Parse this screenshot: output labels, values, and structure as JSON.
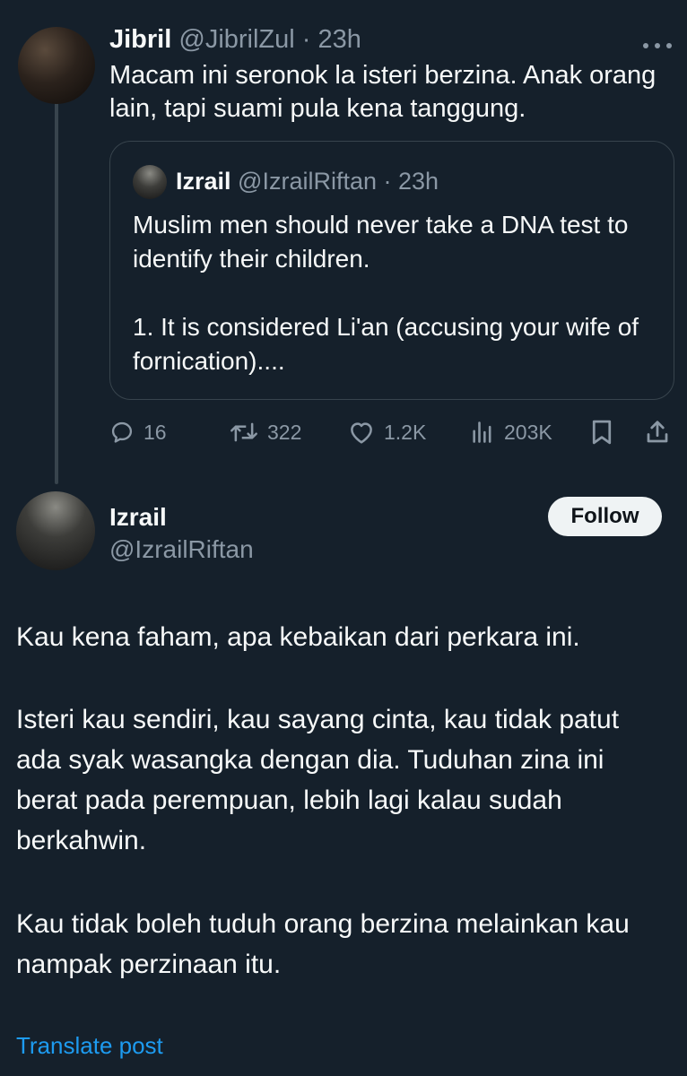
{
  "parent_tweet": {
    "author_name": "Jibril",
    "author_handle": "@JibrilZul",
    "time": "23h",
    "text": "Macam ini seronok la isteri berzina. Anak orang lain, tapi suami pula kena tanggung.",
    "quoted": {
      "author_name": "Izrail",
      "author_handle": "@IzrailRiftan",
      "time": "23h",
      "paragraphs": [
        "Muslim men should never take a DNA test to identify their children.",
        "1. It is considered Li'an (accusing your wife of fornication)...."
      ]
    },
    "metrics": {
      "replies": "16",
      "reposts": "322",
      "likes": "1.2K",
      "views": "203K"
    }
  },
  "reply_tweet": {
    "author_name": "Izrail",
    "author_handle": "@IzrailRiftan",
    "follow_label": "Follow",
    "paragraphs": [
      "Kau kena faham, apa kebaikan dari perkara ini.",
      "Isteri kau sendiri, kau sayang cinta, kau tidak patut ada syak wasangka dengan dia. Tuduhan zina ini berat pada perempuan, lebih lagi kalau sudah berkahwin.",
      "Kau tidak boleh tuduh orang berzina melainkan kau nampak perzinaan itu."
    ],
    "translate_label": "Translate post"
  },
  "icons": {
    "more": "more-horizontal-icon",
    "reply": "reply-icon",
    "repost": "repost-icon",
    "like": "like-icon",
    "views": "views-icon",
    "bookmark": "bookmark-icon",
    "share": "share-icon"
  },
  "colors": {
    "background": "#15202b",
    "text": "#f7f9f9",
    "muted": "#8b98a5",
    "border": "#38444d",
    "link": "#1d9bf0",
    "follow_bg": "#eff3f4"
  }
}
